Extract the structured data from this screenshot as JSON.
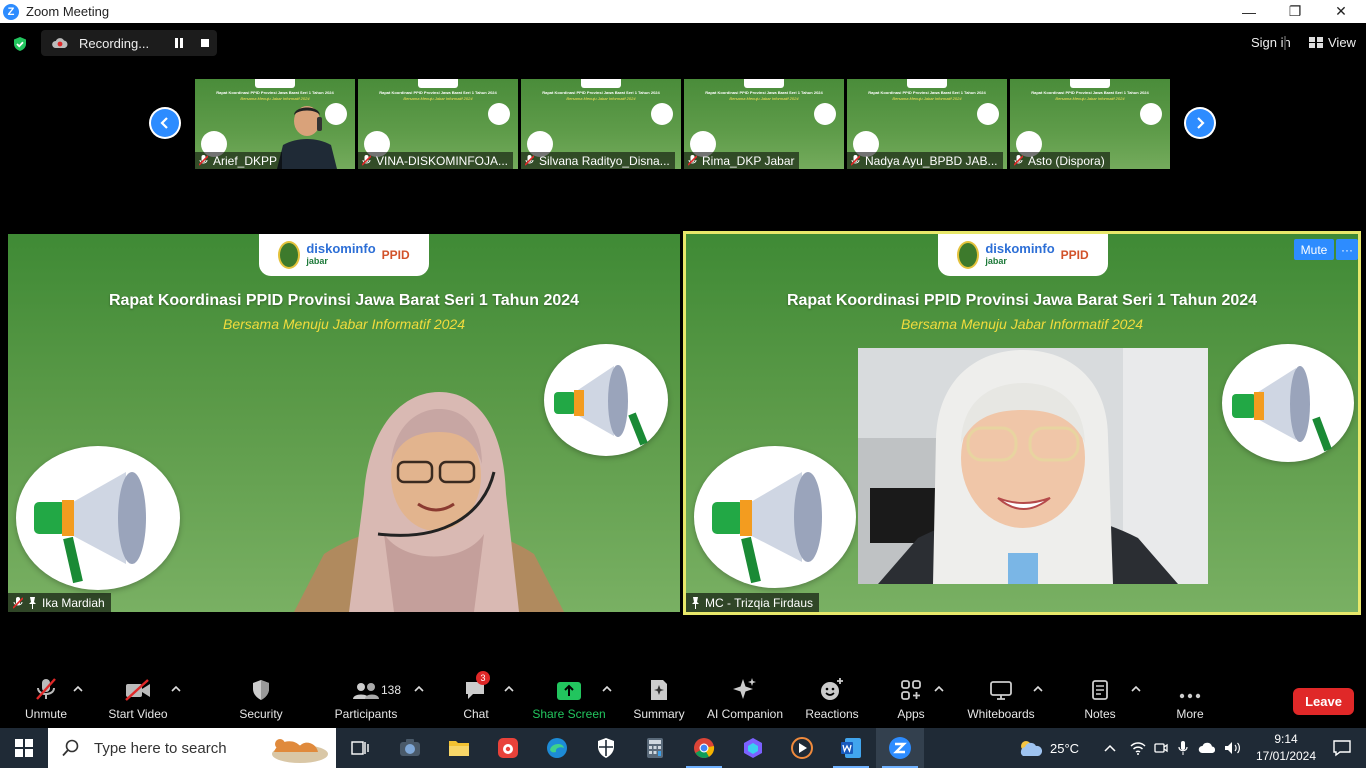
{
  "window": {
    "title": "Zoom Meeting",
    "minimize": "—",
    "restore": "❐",
    "close": "✕"
  },
  "top": {
    "recording_label": "Recording...",
    "sign_in": "Sign in",
    "view": "View"
  },
  "strip": [
    {
      "name": "Arief_DKPP",
      "slide_title": "Rapat Koordinasi PPID Provinsi Jawa Barat Seri 1 Tahun 2024",
      "slide_sub": "Bersama Menuju Jabar Informatif 2024"
    },
    {
      "name": "VINA-DISKOMINFOJA...",
      "slide_title": "Rapat Koordinasi PPID Provinsi Jawa Barat Seri 1 Tahun 2024",
      "slide_sub": "Bersama Menuju Jabar Informatif 2024"
    },
    {
      "name": "Silvana Radityo_Disna...",
      "slide_title": "Rapat Koordinasi PPID Provinsi Jawa Barat Seri 1 Tahun 2024",
      "slide_sub": "Bersama Menuju Jabar Informatif 2024"
    },
    {
      "name": "Rima_DKP Jabar",
      "slide_title": "Rapat Koordinasi PPID Provinsi Jawa Barat Seri 1 Tahun 2024",
      "slide_sub": "Bersama Menuju Jabar Informatif 2024"
    },
    {
      "name": "Nadya Ayu_BPBD JAB...",
      "slide_title": "Rapat Koordinasi PPID Provinsi Jawa Barat Seri 1 Tahun 2024",
      "slide_sub": "Bersama Menuju Jabar Informatif 2024"
    },
    {
      "name": "Asto (Dispora)",
      "slide_title": "Rapat Koordinasi PPID Provinsi Jawa Barat Seri 1 Tahun 2024",
      "slide_sub": "Bersama Menuju Jabar Informatif 2024"
    }
  ],
  "main_tiles": {
    "left": {
      "name": "Ika Mardiah",
      "heading": "Rapat Koordinasi PPID Provinsi Jawa Barat Seri 1 Tahun 2024",
      "subheading": "Bersama Menuju Jabar Informatif 2024",
      "logo_text_a": "diskominfo",
      "logo_text_b": "jabar",
      "logo_text_c": "PPID"
    },
    "right": {
      "name": "MC - Trizqia Firdaus",
      "heading": "Rapat Koordinasi PPID Provinsi Jawa Barat Seri 1 Tahun 2024",
      "subheading": "Bersama Menuju Jabar Informatif 2024",
      "logo_text_a": "diskominfo",
      "logo_text_b": "jabar",
      "logo_text_c": "PPID",
      "mute_label": "Mute",
      "more_label": "···"
    }
  },
  "toolbar": {
    "unmute": "Unmute",
    "start_video": "Start Video",
    "security": "Security",
    "participants": "Participants",
    "participants_count": "138",
    "chat": "Chat",
    "chat_badge": "3",
    "share_screen": "Share Screen",
    "summary": "Summary",
    "ai_companion": "AI Companion",
    "reactions": "Reactions",
    "apps": "Apps",
    "whiteboards": "Whiteboards",
    "notes": "Notes",
    "more": "More",
    "leave": "Leave"
  },
  "taskbar": {
    "search_placeholder": "Type here to search",
    "temperature": "25°C",
    "time": "9:14",
    "date": "17/01/2024"
  },
  "colors": {
    "zoom_blue": "#2d8cff",
    "leave_red": "#e02828",
    "share_green": "#22c55e",
    "active_speaker_border": "#e8e86a",
    "slide_green": "#5b9a48"
  }
}
